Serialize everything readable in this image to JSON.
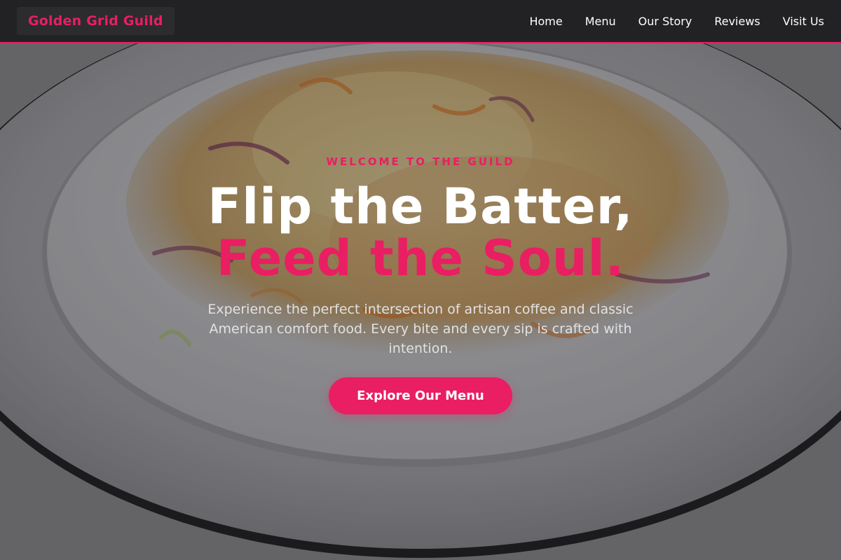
{
  "brand": {
    "name": "Golden Grid Guild",
    "accent_color": "#e91e63"
  },
  "nav": {
    "items": [
      {
        "label": "Home"
      },
      {
        "label": "Menu"
      },
      {
        "label": "Our Story"
      },
      {
        "label": "Reviews"
      },
      {
        "label": "Visit Us"
      }
    ]
  },
  "hero": {
    "background_image": "plate-of-coleslaw-photo",
    "eyebrow": "WELCOME TO THE GUILD",
    "headline_line1": "Flip the Batter,",
    "headline_line2": "Feed the Soul.",
    "subtitle": "Experience the perfect intersection of artisan coffee and classic American comfort food. Every bite and every sip is crafted with intention.",
    "cta_label": "Explore Our Menu"
  }
}
